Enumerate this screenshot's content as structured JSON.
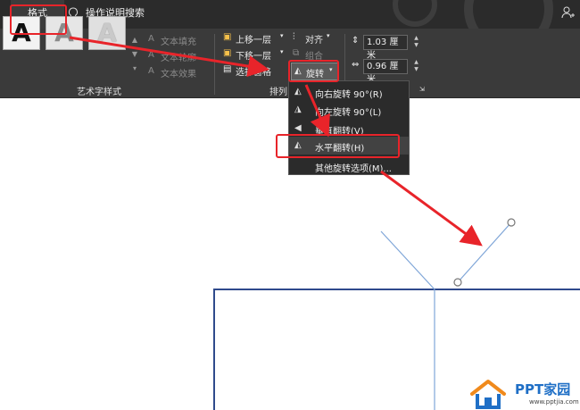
{
  "tabs": {
    "format": "格式",
    "tell_me": "操作说明搜索"
  },
  "wordart": {
    "glyph": "A",
    "options": [
      "文本填充",
      "文本轮廓",
      "文本效果"
    ],
    "group_label": "艺术字样式"
  },
  "arrange": {
    "bring_forward": "上移一层",
    "send_backward": "下移一层",
    "selection_pane": "选择窗格",
    "align": "对齐",
    "group": "组合",
    "rotate": "旋转",
    "group_label": "排列"
  },
  "size": {
    "height": "1.03 厘米",
    "width": "0.96 厘米"
  },
  "rotate_menu": {
    "items": [
      {
        "label": "向右旋转 90°(R)",
        "icon": "rotate-right-icon"
      },
      {
        "label": "向左旋转 90°(L)",
        "icon": "rotate-left-icon"
      },
      {
        "label": "垂直翻转(V)",
        "icon": "flip-vertical-icon"
      },
      {
        "label": "水平翻转(H)",
        "icon": "flip-horizontal-icon"
      },
      {
        "label": "其他旋转选项(M)...",
        "icon": ""
      }
    ]
  },
  "watermark": {
    "title": "PPT家园",
    "url": "www.pptjia.com"
  },
  "colors": {
    "annotation_red": "#e8242a",
    "shape_outline": "#2f4a8c",
    "guide_line": "#7fa6d8",
    "brand_blue": "#1f6fc6",
    "brand_orange": "#f08a1c"
  }
}
